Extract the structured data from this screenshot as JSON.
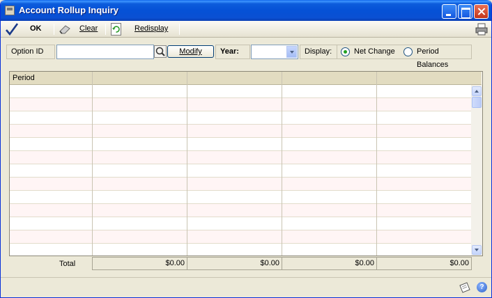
{
  "window": {
    "title": "Account Rollup Inquiry"
  },
  "toolbar": {
    "ok_label": "OK",
    "clear_label": "Clear",
    "redisplay_label": "Redisplay"
  },
  "filters": {
    "option_id_label": "Option ID",
    "option_id_value": "",
    "modify_label": "Modify",
    "year_label": "Year:",
    "year_value": "",
    "display_label": "Display:",
    "display_options": [
      "Net Change",
      "Period Balances"
    ],
    "display_selected": "Net Change"
  },
  "grid": {
    "columns": [
      "Period",
      "",
      "",
      "",
      ""
    ],
    "rows": [
      [
        "",
        "",
        "",
        "",
        ""
      ],
      [
        "",
        "",
        "",
        "",
        ""
      ],
      [
        "",
        "",
        "",
        "",
        ""
      ],
      [
        "",
        "",
        "",
        "",
        ""
      ],
      [
        "",
        "",
        "",
        "",
        ""
      ],
      [
        "",
        "",
        "",
        "",
        ""
      ],
      [
        "",
        "",
        "",
        "",
        ""
      ],
      [
        "",
        "",
        "",
        "",
        ""
      ],
      [
        "",
        "",
        "",
        "",
        ""
      ],
      [
        "",
        "",
        "",
        "",
        ""
      ],
      [
        "",
        "",
        "",
        "",
        ""
      ],
      [
        "",
        "",
        "",
        "",
        ""
      ],
      [
        "",
        "",
        "",
        "",
        ""
      ]
    ]
  },
  "totals": {
    "label": "Total",
    "values": [
      "$0.00",
      "$0.00",
      "$0.00",
      "$0.00"
    ]
  },
  "colors": {
    "titlebar": "#0551d6",
    "window_bg": "#ece9d8",
    "header_bg": "#e2dcc1",
    "alt_row": "#fff5f5"
  },
  "icons": [
    "checkmark-icon",
    "eraser-icon",
    "redisplay-icon",
    "printer-icon",
    "lookup-icon",
    "note-icon",
    "help-icon"
  ]
}
